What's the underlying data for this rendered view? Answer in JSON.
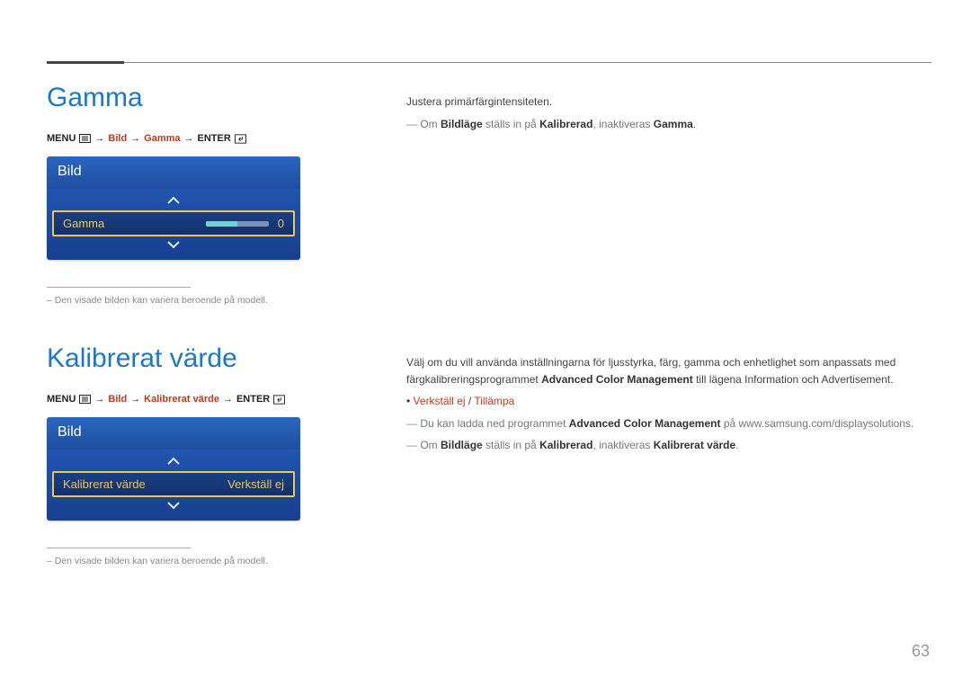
{
  "page_number": "63",
  "section1": {
    "heading": "Gamma",
    "breadcrumb": {
      "menu": "MENU",
      "bild": "Bild",
      "item": "Gamma",
      "enter": "ENTER"
    },
    "osd": {
      "title": "Bild",
      "row_label": "Gamma",
      "row_value": "0"
    },
    "footnote": "–  Den visade bilden kan variera beroende på modell.",
    "desc": {
      "line1": "Justera primärfärgintensiteten.",
      "note_prefix": "Om ",
      "note_bold1": "Bildläge",
      "note_mid": " ställs in på ",
      "note_bold2": "Kalibrerad",
      "note_tail_pre": ", inaktiveras ",
      "note_tail_bold": "Gamma",
      "note_tail_post": "."
    }
  },
  "section2": {
    "heading": "Kalibrerat värde",
    "breadcrumb": {
      "menu": "MENU",
      "bild": "Bild",
      "item": "Kalibrerat värde",
      "enter": "ENTER"
    },
    "osd": {
      "title": "Bild",
      "row_label": "Kalibrerat värde",
      "row_value": "Verkställ ej"
    },
    "footnote": "–  Den visade bilden kan variera beroende på modell.",
    "desc": {
      "p1a": "Välj om du vill använda inställningarna för ljusstyrka, färg, gamma och enhetlighet som anpassats med färgkalibreringsprogrammet ",
      "p1b_bold": "Advanced Color Management",
      "p1c": " till lägena Information och Advertisement.",
      "bullet_a": "Verkställ ej",
      "bullet_sep": " / ",
      "bullet_b": "Tillämpa",
      "note1_pre": "Du kan ladda ned programmet ",
      "note1_bold": "Advanced Color Management",
      "note1_post": " på www.samsung.com/displaysolutions.",
      "note2_pre": "Om ",
      "note2_bold1": "Bildläge",
      "note2_mid": " ställs in på ",
      "note2_bold2": "Kalibrerad",
      "note2_tail_pre": ", inaktiveras ",
      "note2_tail_bold": "Kalibrerat värde",
      "note2_tail_post": "."
    }
  }
}
